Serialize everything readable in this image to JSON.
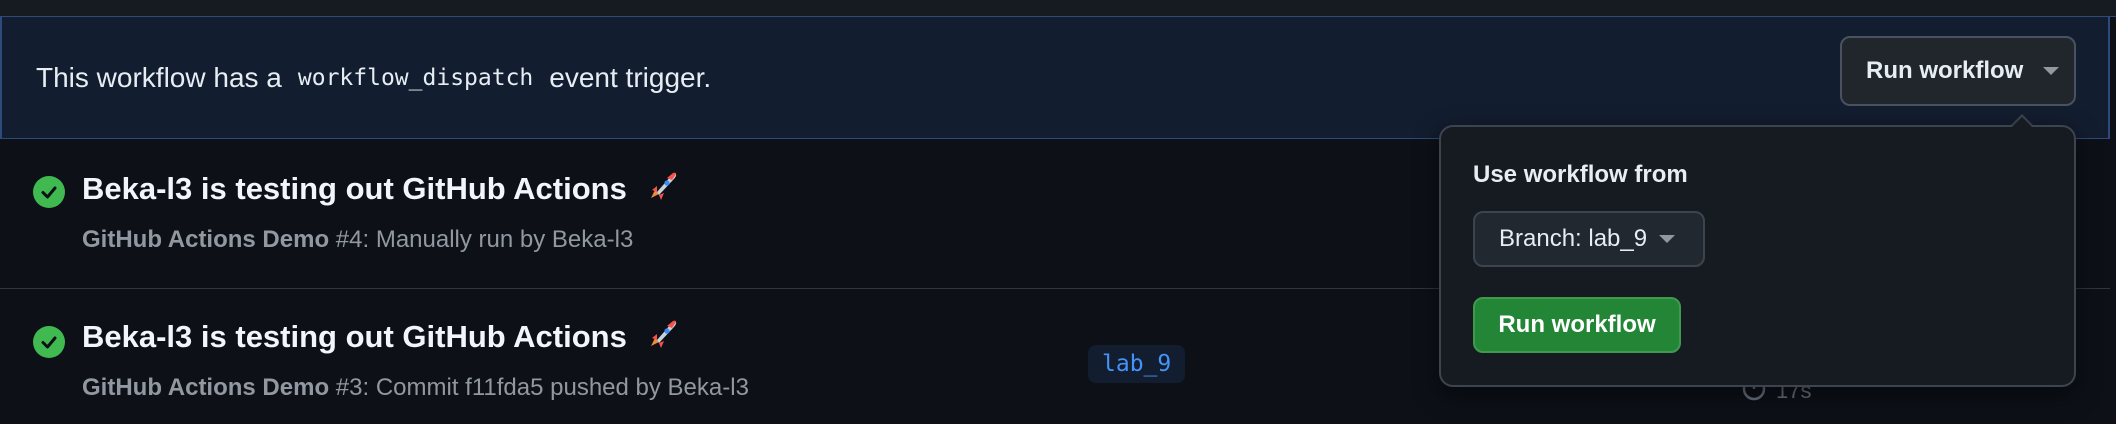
{
  "banner": {
    "text_before": "This workflow has a",
    "code": "workflow_dispatch",
    "text_after": "event trigger.",
    "run_button_label": "Run workflow"
  },
  "runs": [
    {
      "title": "Beka-l3 is testing out GitHub Actions",
      "emoji": "🚀",
      "workflow": "GitHub Actions Demo",
      "number": "#4",
      "detail": ": Manually run by Beka-l3",
      "status": "success"
    },
    {
      "title": "Beka-l3 is testing out GitHub Actions",
      "emoji": "🚀",
      "workflow": "GitHub Actions Demo",
      "number": "#3",
      "detail": ": Commit f11fda5 pushed by Beka-l3",
      "status": "success",
      "branch": "lab_9",
      "duration": "17s"
    }
  ],
  "dropdown": {
    "title": "Use workflow from",
    "branch_label": "Branch: lab_9",
    "run_label": "Run workflow"
  },
  "colors": {
    "background": "#0d1117",
    "success": "#3fb950",
    "primary_button": "#238636",
    "link": "#4493f8"
  },
  "icons": [
    "check-circle-icon",
    "rocket-icon",
    "caret-down-icon",
    "stopwatch-icon"
  ]
}
